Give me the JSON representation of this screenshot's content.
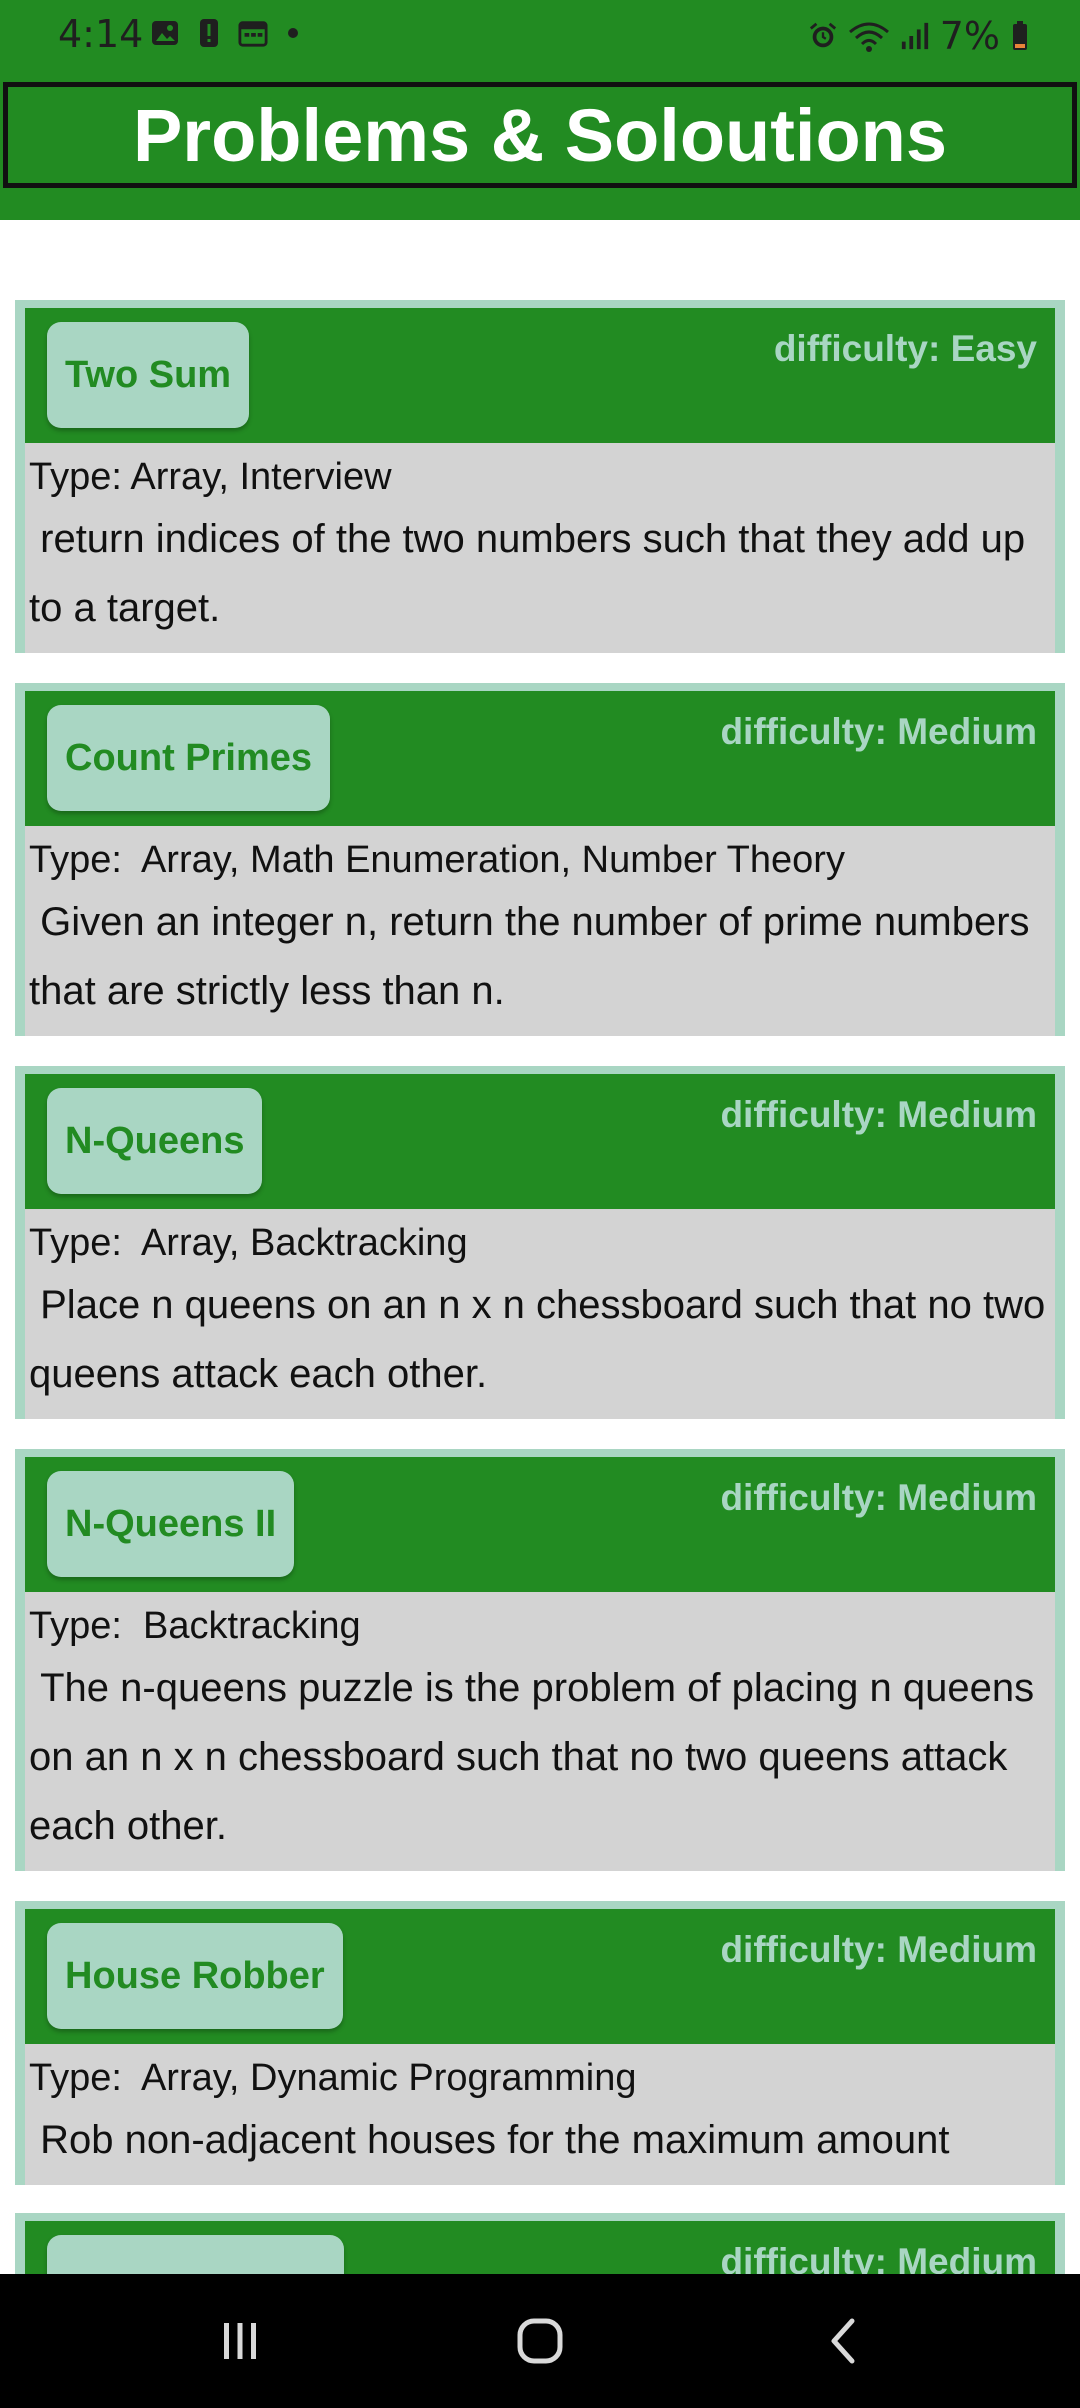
{
  "status_bar": {
    "time": "4:14",
    "battery": "7%",
    "icons_left": [
      "gallery-icon",
      "alert-icon",
      "calendar-icon",
      "dot-icon"
    ],
    "icons_right": [
      "alarm-icon",
      "wifi-icon",
      "signal-icon",
      "battery-icon"
    ]
  },
  "header": {
    "title": "Problems & Soloutions"
  },
  "problems": [
    {
      "name": "Two Sum",
      "difficulty": "difficulty: Easy",
      "type": "Type: Array, Interview",
      "description": " return indices of the two numbers such that they add up to a target."
    },
    {
      "name": "Count Primes",
      "difficulty": "difficulty: Medium",
      "type": "Type:  Array, Math Enumeration, Number Theory",
      "description": " Given an integer n, return the number of prime numbers that are strictly less than n."
    },
    {
      "name": "N-Queens",
      "difficulty": "difficulty: Medium",
      "type": "Type:  Array, Backtracking",
      "description": " Place n queens on an n x n chessboard such that no two queens attack each other."
    },
    {
      "name": "N-Queens II",
      "difficulty": "difficulty: Medium",
      "type": "Type:  Backtracking",
      "description": " The n-queens puzzle is the problem of placing n queens on an n x n chessboard such that no two queens attack each other."
    },
    {
      "name": "House Robber",
      "difficulty": "difficulty: Medium",
      "type": "Type:  Array, Dynamic Programming",
      "description": " Rob non-adjacent houses for the maximum amount"
    },
    {
      "name": "",
      "difficulty": "difficulty: Medium",
      "type": "",
      "description": ""
    }
  ],
  "nav_bar": {
    "buttons": [
      "recent-apps-icon",
      "home-icon",
      "back-icon"
    ]
  },
  "colors": {
    "primary_green": "#228b22",
    "mint": "#a9d6c3",
    "card_body": "#d3d3d3",
    "nav_bg": "#000000"
  }
}
